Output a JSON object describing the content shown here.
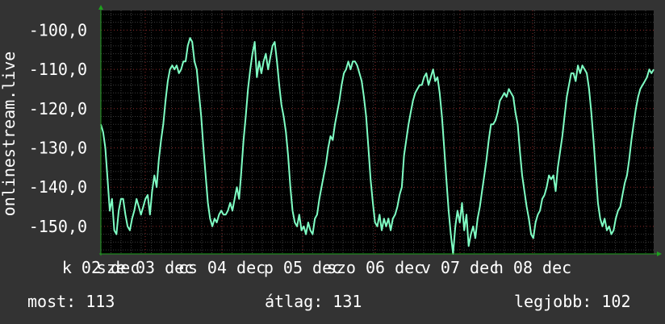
{
  "chart_data": {
    "type": "line",
    "ylabel": "onlinestream.live",
    "ylim": [
      -157,
      -95
    ],
    "yticks": [
      -100,
      -110,
      -120,
      -130,
      -140,
      -150
    ],
    "ytick_labels": [
      "-100,0",
      "-110,0",
      "-120,0",
      "-130,0",
      "-140,0",
      "-150,0"
    ],
    "x_range": [
      0,
      6.85
    ],
    "xticks": [
      {
        "x": 0.0,
        "label": "k 02 dec"
      },
      {
        "x": 0.55,
        "label": "sze 03 dec"
      },
      {
        "x": 1.5,
        "label": "cs 04 dec"
      },
      {
        "x": 2.5,
        "label": "p 05 dec"
      },
      {
        "x": 3.4,
        "label": "szo 06 dec"
      },
      {
        "x": 4.45,
        "label": "v 07 dec"
      },
      {
        "x": 5.35,
        "label": "h 08 dec"
      }
    ],
    "grid": true,
    "line_color": "#7FFFC4",
    "series": [
      {
        "values": [
          -124,
          -126,
          -130,
          -138,
          -146,
          -143,
          -151,
          -152,
          -146,
          -143,
          -143,
          -147,
          -150,
          -151,
          -148,
          -146,
          -143,
          -145,
          -147,
          -145,
          -143,
          -142,
          -147,
          -141,
          -137,
          -140,
          -133,
          -128,
          -124,
          -118,
          -113,
          -110,
          -109,
          -110,
          -109,
          -111,
          -110,
          -108,
          -108,
          -104,
          -102,
          -103,
          -108,
          -110,
          -116,
          -122,
          -130,
          -137,
          -144,
          -148,
          -150,
          -148,
          -149,
          -147,
          -146,
          -147,
          -147,
          -146,
          -144,
          -146,
          -143,
          -140,
          -143,
          -136,
          -128,
          -122,
          -115,
          -110,
          -106,
          -103,
          -112,
          -108,
          -111,
          -108,
          -106,
          -110,
          -107,
          -104,
          -103,
          -108,
          -114,
          -119,
          -122,
          -126,
          -132,
          -140,
          -146,
          -149,
          -150,
          -147,
          -151,
          -150,
          -152,
          -149,
          -151,
          -152,
          -148,
          -147,
          -143,
          -140,
          -137,
          -134,
          -130,
          -127,
          -128,
          -124,
          -121,
          -118,
          -114,
          -111,
          -110,
          -108,
          -110,
          -108,
          -108,
          -109,
          -111,
          -113,
          -117,
          -122,
          -130,
          -138,
          -144,
          -149,
          -150,
          -147,
          -151,
          -148,
          -150,
          -148,
          -151,
          -148,
          -147,
          -145,
          -142,
          -140,
          -132,
          -128,
          -124,
          -121,
          -118,
          -116,
          -115,
          -114,
          -114,
          -112,
          -111,
          -114,
          -112,
          -110,
          -113,
          -112,
          -116,
          -122,
          -130,
          -138,
          -146,
          -152,
          -157,
          -150,
          -146,
          -149,
          -144,
          -151,
          -147,
          -155,
          -152,
          -150,
          -153,
          -148,
          -145,
          -141,
          -137,
          -133,
          -128,
          -124,
          -124,
          -123,
          -121,
          -118,
          -117,
          -116,
          -117,
          -115,
          -116,
          -117,
          -121,
          -124,
          -131,
          -137,
          -141,
          -145,
          -148,
          -152,
          -153,
          -149,
          -147,
          -146,
          -143,
          -142,
          -140,
          -137,
          -138,
          -137,
          -141,
          -135,
          -131,
          -127,
          -122,
          -117,
          -114,
          -111,
          -111,
          -113,
          -109,
          -111,
          -109,
          -110,
          -111,
          -115,
          -121,
          -128,
          -136,
          -144,
          -148,
          -150,
          -148,
          -151,
          -150,
          -152,
          -151,
          -148,
          -146,
          -145,
          -142,
          -139,
          -137,
          -133,
          -128,
          -124,
          -120,
          -117,
          -115,
          -114,
          -113,
          -112,
          -110,
          -111,
          -110
        ]
      }
    ]
  },
  "stats": {
    "now_label": "most:",
    "now_value": "113",
    "avg_label": "átlag:",
    "avg_value": "131",
    "best_label": "legjobb:",
    "best_value": "102"
  }
}
